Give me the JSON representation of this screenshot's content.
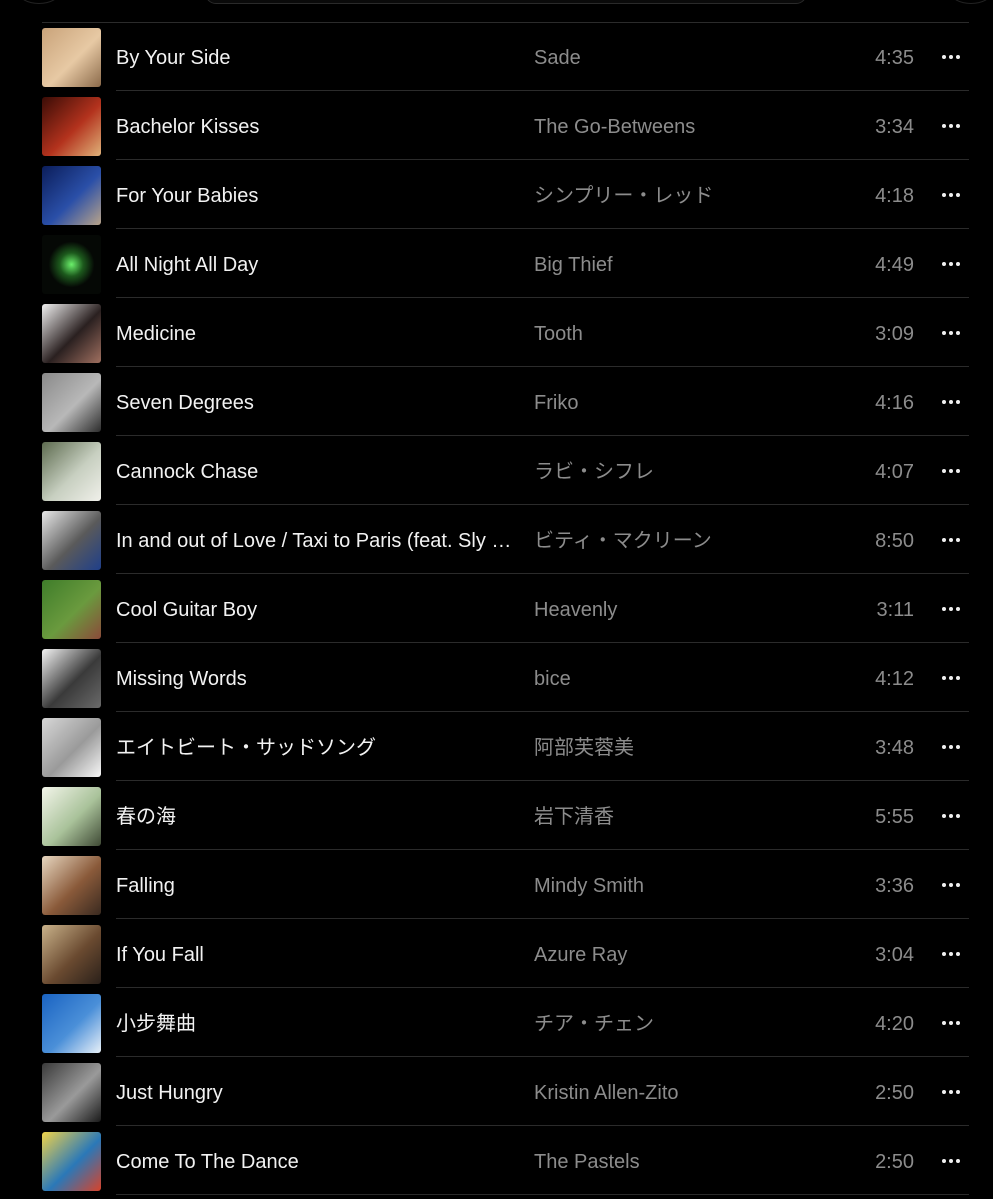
{
  "tracks": [
    {
      "title": "By Your Side",
      "artist": "Sade",
      "duration": "4:35",
      "art_icon": "album-art-by-your-side",
      "art_colors": [
        "#c9a37a",
        "#e7c9a4",
        "#8b6a4a"
      ]
    },
    {
      "title": "Bachelor Kisses",
      "artist": "The Go-Betweens",
      "duration": "3:34",
      "art_icon": "album-art-bachelor-kisses",
      "art_colors": [
        "#3a0c06",
        "#b3321d",
        "#e0b27a"
      ]
    },
    {
      "title": "For Your Babies",
      "artist": "シンプリー・レッド",
      "duration": "4:18",
      "art_icon": "album-art-for-your-babies",
      "art_colors": [
        "#0b1d5a",
        "#2a4fa8",
        "#b9a48a"
      ]
    },
    {
      "title": "All Night All Day",
      "artist": "Big Thief",
      "duration": "4:49",
      "art_icon": "album-art-all-night-all-day",
      "art_colors": [
        "#050805",
        "#1d5a1d",
        "#6bf06b"
      ]
    },
    {
      "title": "Medicine",
      "artist": "Tooth",
      "duration": "3:09",
      "art_icon": "album-art-medicine",
      "art_colors": [
        "#f1f1f1",
        "#2a2020",
        "#a07060"
      ]
    },
    {
      "title": "Seven Degrees",
      "artist": "Friko",
      "duration": "4:16",
      "art_icon": "album-art-seven-degrees",
      "art_colors": [
        "#8a8a8a",
        "#b8b8b8",
        "#2c2c2c"
      ]
    },
    {
      "title": "Cannock Chase",
      "artist": "ラビ・シフレ",
      "duration": "4:07",
      "art_icon": "album-art-cannock-chase",
      "art_colors": [
        "#5d6b4f",
        "#c7cfc0",
        "#f0f0ea"
      ]
    },
    {
      "title": "In and out of Love / Taxi to Paris (feat. Sly & Robbie)",
      "artist": "ビティ・マクリーン",
      "duration": "8:50",
      "art_icon": "album-art-in-and-out-of-love",
      "art_colors": [
        "#e8e8e8",
        "#5a5a5a",
        "#1f3f8a"
      ]
    },
    {
      "title": "Cool Guitar Boy",
      "artist": "Heavenly",
      "duration": "3:11",
      "art_icon": "album-art-cool-guitar-boy",
      "art_colors": [
        "#3f7d2a",
        "#6a9a3e",
        "#8b4a3a"
      ]
    },
    {
      "title": "Missing Words",
      "artist": "bice",
      "duration": "4:12",
      "art_icon": "album-art-missing-words",
      "art_colors": [
        "#f4f4f4",
        "#3a3a3a",
        "#6a6a6a"
      ]
    },
    {
      "title": "エイトビート・サッドソング",
      "artist": "阿部芙蓉美",
      "duration": "3:48",
      "art_icon": "album-art-eight-beat-sad-song",
      "art_colors": [
        "#d7d7d7",
        "#9a9a9a",
        "#f8f8f8"
      ]
    },
    {
      "title": "春の海",
      "artist": "岩下清香",
      "duration": "5:55",
      "art_icon": "album-art-haru-no-umi",
      "art_colors": [
        "#f3f5ea",
        "#a9c29a",
        "#3f4a35"
      ]
    },
    {
      "title": "Falling",
      "artist": "Mindy Smith",
      "duration": "3:36",
      "art_icon": "album-art-falling",
      "art_colors": [
        "#e7d7c0",
        "#8a5a3a",
        "#3a2a20"
      ]
    },
    {
      "title": "If You Fall",
      "artist": "Azure Ray",
      "duration": "3:04",
      "art_icon": "album-art-if-you-fall",
      "art_colors": [
        "#c9b28a",
        "#6a4a30",
        "#2a201a"
      ]
    },
    {
      "title": "小步舞曲",
      "artist": "チア・チェン",
      "duration": "4:20",
      "art_icon": "album-art-minuet",
      "art_colors": [
        "#1a63c2",
        "#4a8fd8",
        "#e8f0f8"
      ]
    },
    {
      "title": "Just Hungry",
      "artist": "Kristin Allen-Zito",
      "duration": "2:50",
      "art_icon": "album-art-just-hungry",
      "art_colors": [
        "#3a3a3a",
        "#9a9a9a",
        "#1a1a1a"
      ]
    },
    {
      "title": "Come To The Dance",
      "artist": "The Pastels",
      "duration": "2:50",
      "art_icon": "album-art-come-to-the-dance",
      "art_colors": [
        "#f0d34a",
        "#2a78b8",
        "#d8432a"
      ]
    }
  ],
  "more_icon": "ellipsis-icon"
}
